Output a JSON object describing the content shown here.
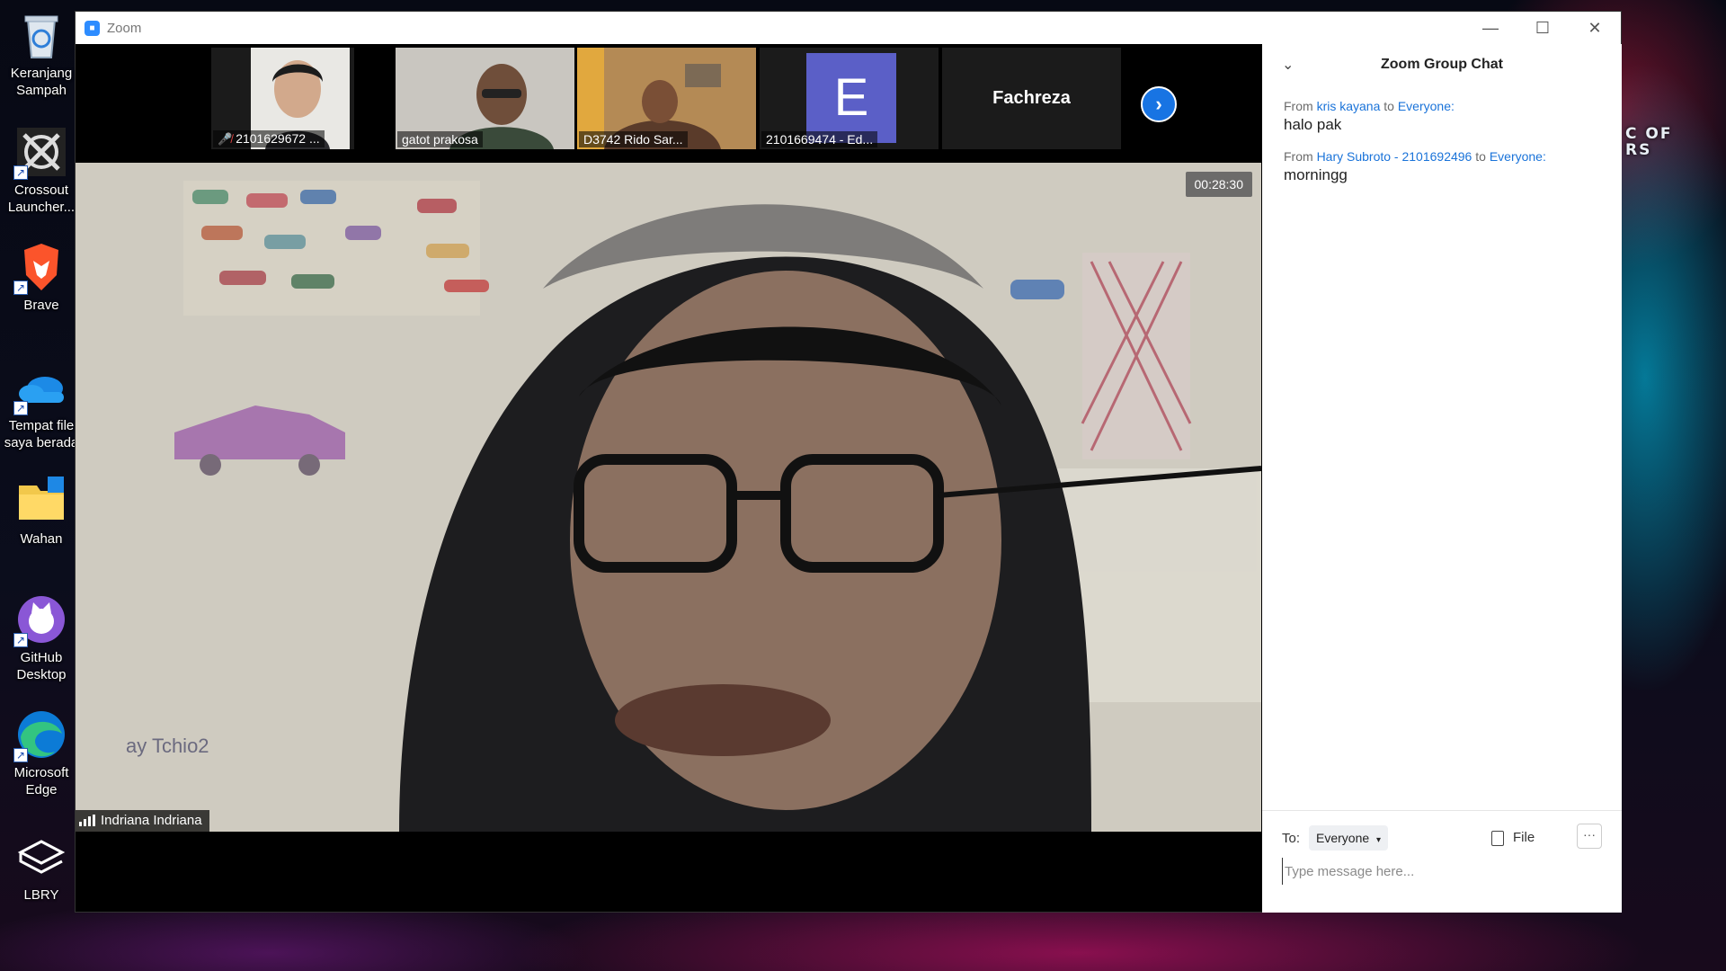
{
  "desktop": {
    "icons": [
      {
        "label": "Keranjang Sampah",
        "icon": "recycle-bin-icon"
      },
      {
        "label": "Crossout Launcher...",
        "icon": "crossout-icon"
      },
      {
        "label": "Brave",
        "icon": "brave-icon"
      },
      {
        "label": "Tempat file saya berada",
        "icon": "onedrive-icon"
      },
      {
        "label": "Wahan",
        "icon": "folder-icon"
      },
      {
        "label": "GitHub Desktop",
        "icon": "github-desktop-icon"
      },
      {
        "label": "Microsoft Edge",
        "icon": "edge-icon"
      },
      {
        "label": "LBRY",
        "icon": "lbry-icon"
      }
    ],
    "rog_text": "C OF\nRS"
  },
  "window": {
    "title": "Zoom",
    "controls": {
      "minimize": "—",
      "maximize": "☐",
      "close": "✕"
    }
  },
  "gallery": {
    "participants": [
      {
        "name": "2101629672 ...",
        "muted": true
      },
      {
        "name": "gatot prakosa"
      },
      {
        "name": "D3742 Rido Sar..."
      },
      {
        "name": "2101669474 - Ed...",
        "initial": "E"
      },
      {
        "name": "Fachreza"
      }
    ],
    "next_icon": "›"
  },
  "speaker": {
    "name": "Indriana Indriana",
    "timer": "00:28:30"
  },
  "chat": {
    "title": "Zoom Group Chat",
    "messages": [
      {
        "from_label": "From",
        "sender": "kris kayana",
        "to_label": "to",
        "recipient": "Everyone:",
        "text": "halo pak"
      },
      {
        "from_label": "From",
        "sender": "Hary Subroto - 2101692496",
        "to_label": "to",
        "recipient": "Everyone:",
        "text": "morningg"
      }
    ],
    "to_label": "To:",
    "recipient_select": "Everyone",
    "file_label": "File",
    "more_label": "···",
    "input_placeholder": "Type message here..."
  },
  "colors": {
    "accent": "#2d8cff",
    "link": "#1a73d9",
    "initial_tile": "#5b5fc7"
  }
}
